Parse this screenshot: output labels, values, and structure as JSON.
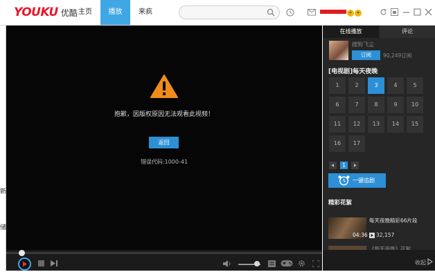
{
  "app": {
    "logo_en": "YOUKU",
    "logo_cn": "优酷"
  },
  "nav": [
    {
      "label": "主页"
    },
    {
      "label": "播放"
    },
    {
      "label": "来疯"
    }
  ],
  "search": {
    "placeholder": ""
  },
  "left_window": {
    "chars": [
      "新",
      "储"
    ]
  },
  "player": {
    "error_message": "抱歉，因版权原因无法观看此视频！",
    "back_button": "返回",
    "error_code": "错误代码:1000-41"
  },
  "right_panel": {
    "tabs": [
      {
        "label": "在线播放"
      },
      {
        "label": "评论"
      }
    ],
    "uploader": {
      "name": "搜狗飞尘",
      "subscribe_label": "订阅",
      "subscriber_count": "90,249订阅"
    },
    "show_title": "[电视剧]每天夜晚",
    "episodes": [
      "1",
      "2",
      "3",
      "4",
      "5",
      "6",
      "7",
      "8",
      "9",
      "10",
      "11",
      "12",
      "13",
      "14",
      "15",
      "16",
      "17"
    ],
    "current_episode": "3",
    "pages": [
      "1"
    ],
    "follow_button": "一键追剧",
    "highlights_title": "精彩花絮",
    "videos": [
      {
        "title": "每天夜晚精彩66片段",
        "duration": "04:36",
        "plays": "32,157"
      },
      {
        "title": "《每天夜晚》花絮",
        "duration": "",
        "plays": ""
      }
    ],
    "collapse_label": "收起"
  },
  "colors": {
    "accent": "#2d8fd6",
    "brand": "#e8162c",
    "warning": "#f08c1c"
  }
}
